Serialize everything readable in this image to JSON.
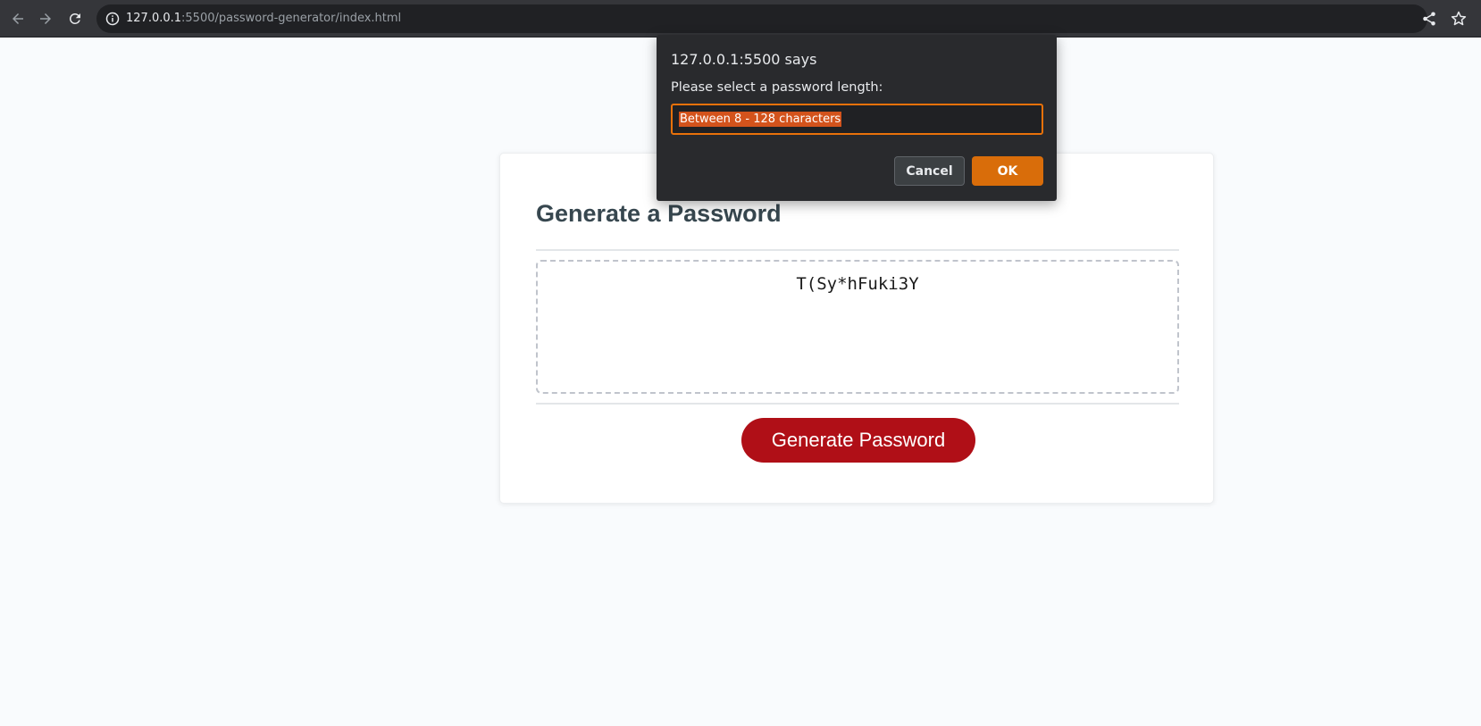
{
  "browser": {
    "url_host": "127.0.0.1",
    "url_rest": ":5500/password-generator/index.html"
  },
  "page": {
    "title": "Generate a Password",
    "password": "T(Sy*hFuki3Y",
    "generate_label": "Generate Password"
  },
  "dialog": {
    "title": "127.0.0.1:5500 says",
    "message": "Please select a password length:",
    "input_value": "Between 8 - 128 characters",
    "cancel_label": "Cancel",
    "ok_label": "OK"
  },
  "colors": {
    "accent_button": "#b00f17",
    "dialog_ok": "#d96d0a",
    "dialog_focus": "#e8710a"
  }
}
